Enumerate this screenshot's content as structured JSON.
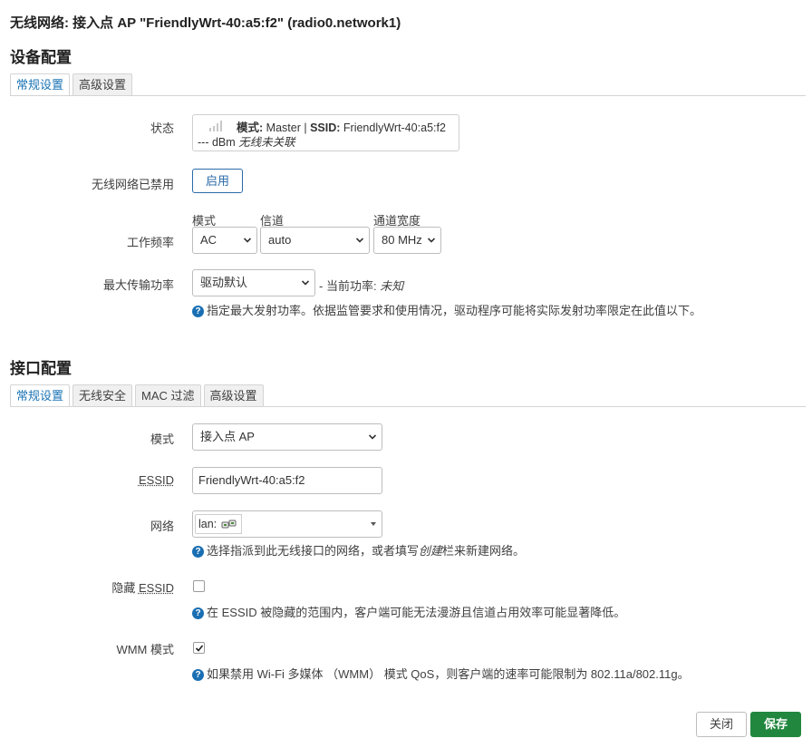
{
  "header": {
    "title": "无线网络: 接入点 AP \"FriendlyWrt-40:a5:f2\" (radio0.network1)"
  },
  "device": {
    "title": "设备配置",
    "tabs": [
      {
        "label": "常规设置",
        "active": true
      },
      {
        "label": "高级设置",
        "active": false
      }
    ],
    "status": {
      "label": "状态",
      "mode_key": "模式:",
      "mode_value": "Master",
      "sep": "|",
      "ssid_key": "SSID:",
      "ssid_value": "FriendlyWrt-40:a5:f2",
      "signal": "--- dBm",
      "assoc": "无线未关联"
    },
    "disabled": {
      "label": "无线网络已禁用",
      "button": "启用"
    },
    "freq": {
      "label": "工作频率",
      "mode_label": "模式",
      "mode_value": "AC",
      "channel_label": "信道",
      "channel_value": "auto",
      "width_label": "通道宽度",
      "width_value": "80 MHz"
    },
    "txpower": {
      "label": "最大传输功率",
      "value": "驱动默认",
      "current_prefix": "- 当前功率:",
      "current_value": "未知",
      "help": "指定最大发射功率。依据监管要求和使用情况，驱动程序可能将实际发射功率限定在此值以下。"
    }
  },
  "iface": {
    "title": "接口配置",
    "tabs": [
      {
        "label": "常规设置",
        "active": true
      },
      {
        "label": "无线安全",
        "active": false
      },
      {
        "label": "MAC 过滤",
        "active": false
      },
      {
        "label": "高级设置",
        "active": false
      }
    ],
    "mode": {
      "label": "模式",
      "value": "接入点 AP"
    },
    "essid": {
      "label": "ESSID",
      "value": "FriendlyWrt-40:a5:f2"
    },
    "network": {
      "label": "网络",
      "value": "lan:",
      "help_a": "选择指派到此无线接口的网络，或者填写",
      "help_em": "创建",
      "help_b": "栏来新建网络。"
    },
    "hidden": {
      "label_a": "隐藏 ",
      "label_b": "ESSID",
      "checked": false,
      "help": "在 ESSID 被隐藏的范围内，客户端可能无法漫游且信道占用效率可能显著降低。"
    },
    "wmm": {
      "label": "WMM 模式",
      "checked": true,
      "help": "如果禁用 Wi-Fi 多媒体 （WMM） 模式 QoS，则客户端的速率可能限制为 802.11a/802.11g。"
    }
  },
  "footer": {
    "close": "关闭",
    "save": "保存"
  },
  "colors": {
    "accent": "#1a73b5",
    "save": "#21873f",
    "help_icon": "#1a6fb3"
  },
  "icons": {
    "signal": "signal-bars-icon",
    "help": "question-circle-icon",
    "chevron": "chevron-down-icon",
    "network": "network-ports-icon"
  }
}
